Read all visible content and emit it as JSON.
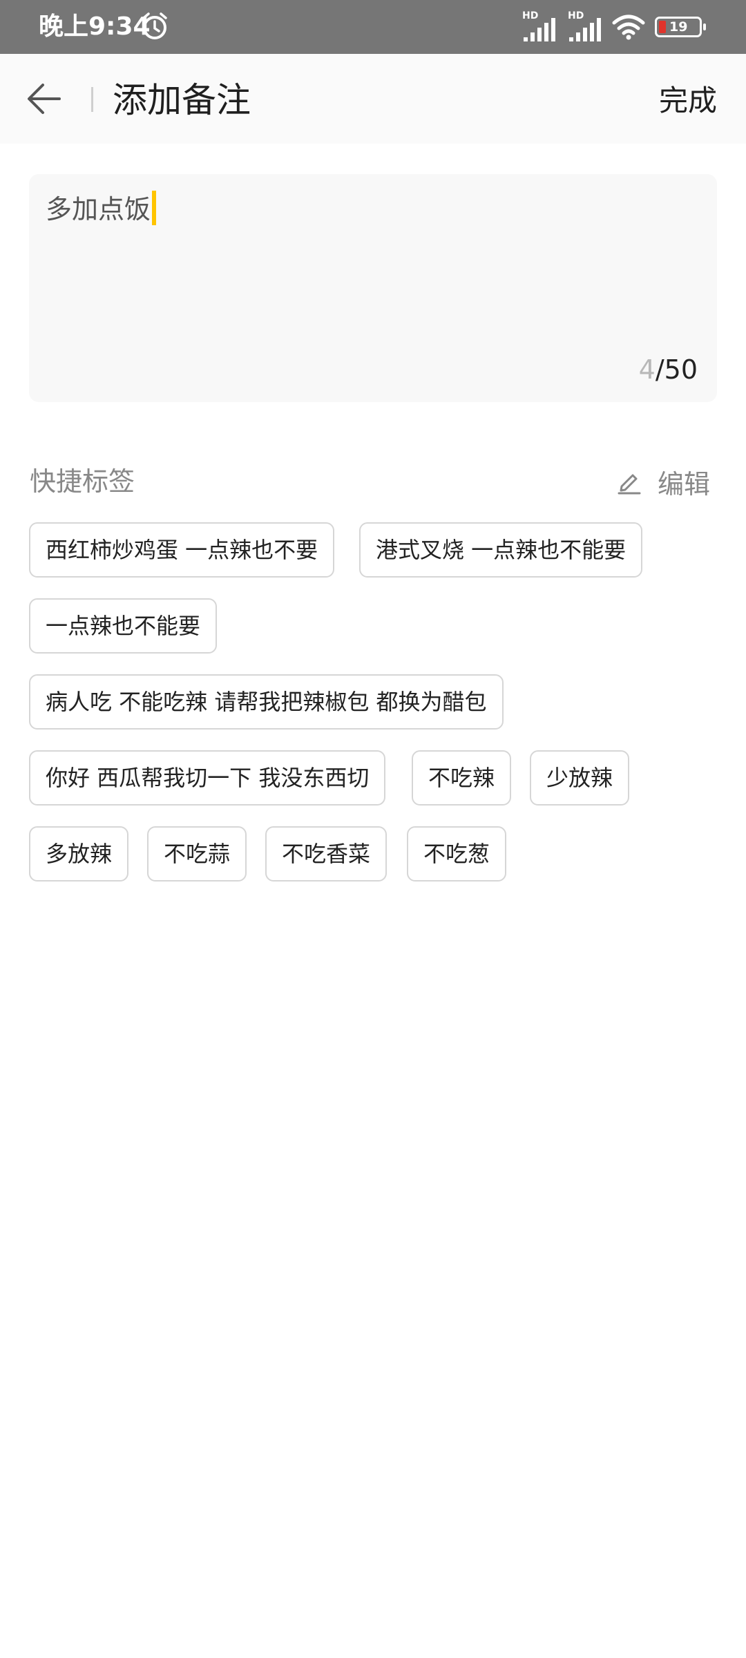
{
  "status_bar": {
    "time": "晚上9:34",
    "signal_1_label": "HD",
    "signal_2_label": "HD",
    "battery": "19"
  },
  "header": {
    "title": "添加备注",
    "done_label": "完成"
  },
  "remark": {
    "value": "多加点饭",
    "count_current": "4",
    "count_max": "/50"
  },
  "quick_tags": {
    "title": "快捷标签",
    "edit_label": "编辑",
    "items": [
      "西红柿炒鸡蛋 一点辣也不要",
      "港式叉烧 一点辣也不能要",
      "一点辣也不能要",
      "病人吃 不能吃辣 请帮我把辣椒包 都换为醋包",
      "你好 西瓜帮我切一下 我没东西切",
      "不吃辣",
      "少放辣",
      "多放辣",
      "不吃蒜",
      "不吃香菜",
      "不吃葱"
    ]
  },
  "colors": {
    "status_bar": "#767676",
    "caret": "#ffc400",
    "battery_low": "#e0342c"
  }
}
